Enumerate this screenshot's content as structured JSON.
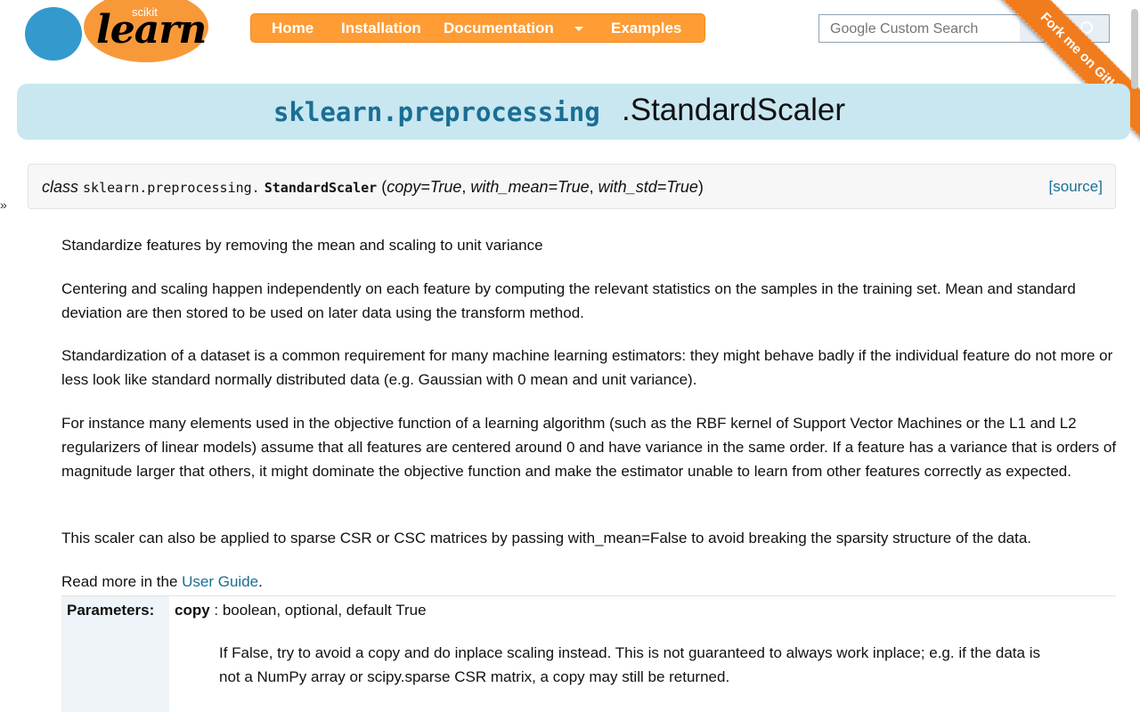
{
  "logo": {
    "top_text": "scikit",
    "main_text": "learn"
  },
  "nav": {
    "items": [
      "Home",
      "Installation",
      "Documentation",
      "Examples"
    ]
  },
  "search": {
    "placeholder": "Google Custom Search"
  },
  "ribbon": {
    "label": "Fork me on GitHub"
  },
  "title": {
    "module": "sklearn.preprocessing",
    "classname": ".StandardScaler"
  },
  "side_arrow": "»",
  "signature": {
    "keyword": "class",
    "module": "sklearn.preprocessing.",
    "name": "StandardScaler",
    "open": "(",
    "params": [
      "copy=True",
      "with_mean=True",
      "with_std=True"
    ],
    "close": ")",
    "source_label": "[source]"
  },
  "paragraphs": [
    "Standardize features by removing the mean and scaling to unit variance",
    "Centering and scaling happen independently on each feature by computing the relevant statistics on the samples in the training set. Mean and standard deviation are then stored to be used on later data using the transform method.",
    "Standardization of a dataset is a common requirement for many machine learning estimators: they might behave badly if the individual feature do not more or less look like standard normally distributed data (e.g. Gaussian with 0 mean and unit variance).",
    "For instance many elements used in the objective function of a learning algorithm (such as the RBF kernel of Support Vector Machines or the L1 and L2 regularizers of linear models) assume that all features are centered around 0 and have variance in the same order. If a feature has a variance that is orders of magnitude larger that others, it might dominate the objective function and make the estimator unable to learn from other features correctly as expected.",
    "This scaler can also be applied to sparse CSR or CSC matrices by passing with_mean=False to avoid breaking the sparsity structure of the data."
  ],
  "read_more": {
    "prefix": "Read more in the ",
    "link": "User Guide",
    "suffix": "."
  },
  "parameters": {
    "label": "Parameters:",
    "items": [
      {
        "name": "copy",
        "type": " : boolean, optional, default True",
        "description": "If False, try to avoid a copy and do inplace scaling instead. This is not guaranteed to always work inplace; e.g. if the data is not a NumPy array or scipy.sparse CSR matrix, a copy may still be returned."
      }
    ]
  },
  "colors": {
    "nav_orange": "#ff9c34",
    "title_banner": "#c8e7f0",
    "link_blue": "#1a6e95",
    "ribbon_orange": "#f07c1e"
  }
}
